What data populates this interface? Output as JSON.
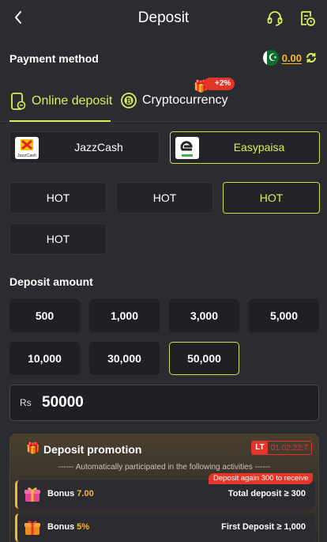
{
  "header": {
    "title": "Deposit"
  },
  "payment": {
    "label": "Payment method",
    "balance": "0.00",
    "flag_symbol": "☪"
  },
  "tabs": [
    {
      "label": "Online deposit",
      "active": true
    },
    {
      "label": "Cryptocurrency",
      "active": false,
      "badge": "+2%"
    }
  ],
  "methods": [
    {
      "name": "JazzCash",
      "logo_text": "JazzCash",
      "selected": false
    },
    {
      "name": "Easypaisa",
      "selected": true
    }
  ],
  "channels": [
    {
      "label": "HOT",
      "selected": false
    },
    {
      "label": "HOT",
      "selected": false
    },
    {
      "label": "HOT",
      "selected": true
    },
    {
      "label": "HOT",
      "selected": false
    }
  ],
  "amount": {
    "label": "Deposit amount",
    "options": [
      "500",
      "1,000",
      "3,000",
      "5,000",
      "10,000",
      "30,000",
      "50,000"
    ],
    "selected_index": 6,
    "currency": "Rs",
    "value": "50000"
  },
  "promotion": {
    "title": "Deposit promotion",
    "lt_tag": "LT",
    "timer": "01:02:22:7",
    "subtitle": "------ Automatically participated in the following activities ------",
    "rows": [
      {
        "label": "Bonus",
        "value": "7.00",
        "condition": "Total deposit ≥ 300",
        "tag": "Deposit again 300 to receive"
      },
      {
        "label": "Bonus",
        "value": "5%",
        "condition": "First Deposit ≥ 1,000"
      }
    ]
  },
  "colors": {
    "accent": "#d6f15a",
    "gold": "#f5b82e",
    "red": "#e2362b",
    "background": "#2b2c30"
  }
}
